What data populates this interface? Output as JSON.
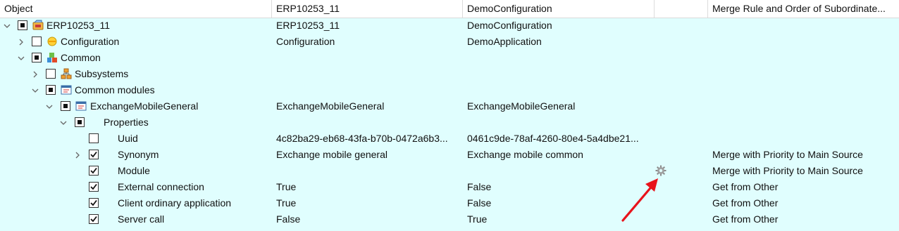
{
  "columns": [
    "Object",
    "ERP10253_11",
    "DemoConfiguration",
    "",
    "Merge Rule and Order of Subordinate..."
  ],
  "rows": [
    {
      "label": "ERP10253_11",
      "c2": "ERP10253_11",
      "c3": "DemoConfiguration",
      "c5": ""
    },
    {
      "label": "Configuration",
      "c2": "Configuration",
      "c3": "DemoApplication",
      "c5": ""
    },
    {
      "label": "Common",
      "c2": "",
      "c3": "",
      "c5": ""
    },
    {
      "label": "Subsystems",
      "c2": "",
      "c3": "",
      "c5": ""
    },
    {
      "label": "Common modules",
      "c2": "",
      "c3": "",
      "c5": ""
    },
    {
      "label": "ExchangeMobileGeneral",
      "c2": "ExchangeMobileGeneral",
      "c3": "ExchangeMobileGeneral",
      "c5": ""
    },
    {
      "label": "Properties",
      "c2": "",
      "c3": "",
      "c5": ""
    },
    {
      "label": "Uuid",
      "c2": "4c82ba29-eb68-43fa-b70b-0472a6b3...",
      "c3": "0461c9de-78af-4260-80e4-5a4dbe21...",
      "c5": ""
    },
    {
      "label": "Synonym",
      "c2": "Exchange mobile general",
      "c3": "Exchange mobile common",
      "c5": "Merge with Priority to Main Source"
    },
    {
      "label": "Module",
      "c2": "",
      "c3": "",
      "c5": "Merge with Priority to Main Source"
    },
    {
      "label": "External connection",
      "c2": "True",
      "c3": "False",
      "c5": "Get from Other"
    },
    {
      "label": "Client ordinary application",
      "c2": "True",
      "c3": "False",
      "c5": "Get from Other"
    },
    {
      "label": "Server call",
      "c2": "False",
      "c3": "True",
      "c5": "Get from Other"
    }
  ],
  "colors": {
    "background": "#e0fefe",
    "arrow": "#e8131b"
  }
}
